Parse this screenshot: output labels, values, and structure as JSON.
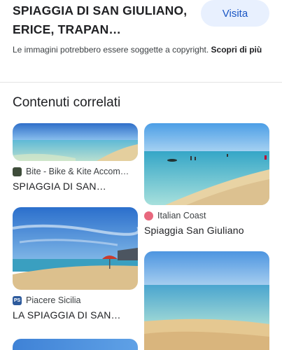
{
  "header": {
    "title": "SPIAGGIA DI SAN GIULIANO, ERICE, TRAPAN…",
    "visit_label": "Visita",
    "copyright_text": "Le immagini potrebbero essere soggette a copyright.",
    "copyright_more": "Scopri di più"
  },
  "related": {
    "title": "Contenuti correlati",
    "cards": [
      {
        "source": "Bite - Bike & Kite Accom…",
        "caption": "SPIAGGIA DI SAN…",
        "favicon": "bite-favicon-icon"
      },
      {
        "source": "Italian Coast",
        "caption": "Spiaggia San Giuliano",
        "favicon": "italian-coast-favicon-icon"
      },
      {
        "source": "Piacere Sicilia",
        "caption": "LA SPIAGGIA DI SAN…",
        "favicon": "piacere-sicilia-favicon-icon",
        "favicon_text": "PS"
      },
      {
        "source": "",
        "caption": ""
      }
    ]
  },
  "colors": {
    "visit_bg": "#e8f0fe",
    "visit_text": "#1a56c4",
    "sky": "#4a8fd8",
    "sea": "#6fc7d8",
    "sand": "#e8cc96"
  }
}
